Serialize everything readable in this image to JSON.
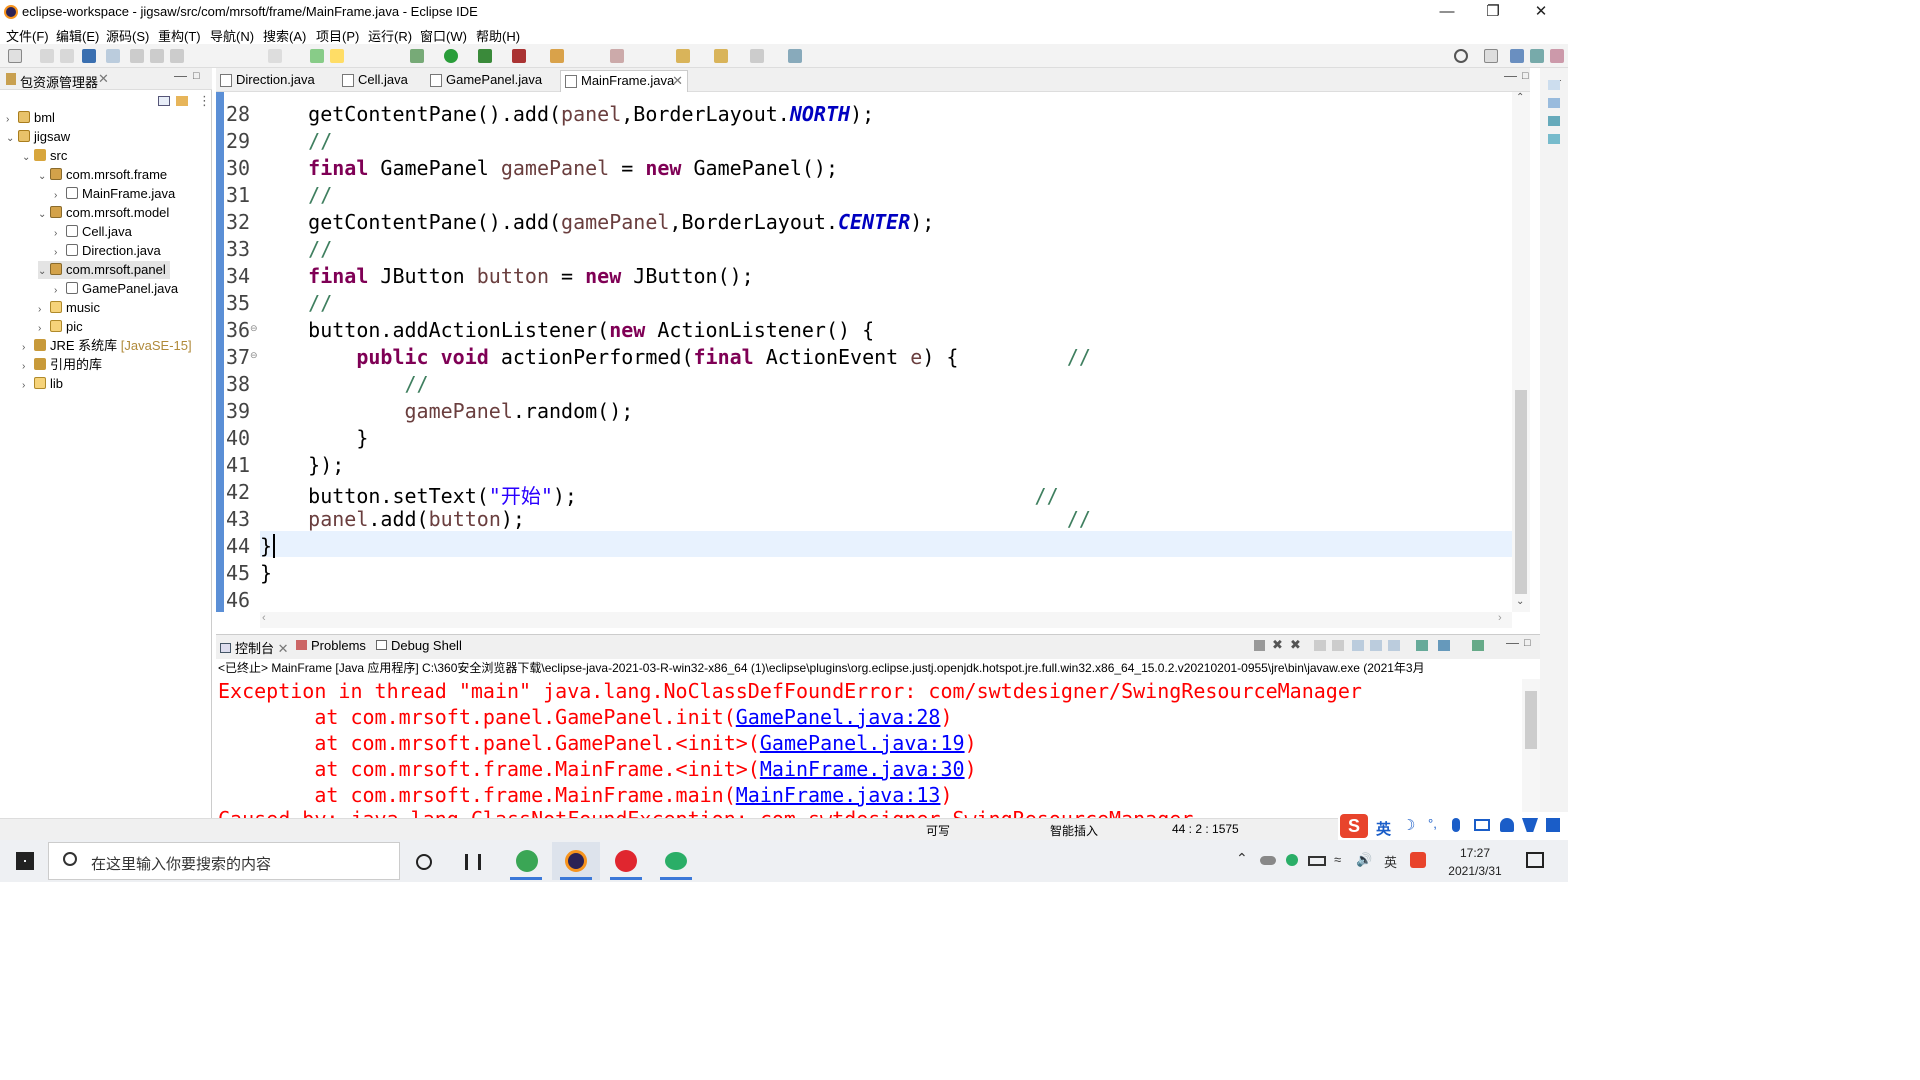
{
  "window": {
    "title": "eclipse-workspace - jigsaw/src/com/mrsoft/frame/MainFrame.java - Eclipse IDE"
  },
  "menu": [
    "文件(F)",
    "编辑(E)",
    "源码(S)",
    "重构(T)",
    "导航(N)",
    "搜索(A)",
    "项目(P)",
    "运行(R)",
    "窗口(W)",
    "帮助(H)"
  ],
  "explorer": {
    "title": "包资源管理器",
    "items": [
      {
        "label": "bml",
        "extra": ""
      },
      {
        "label": "jigsaw",
        "extra": ""
      },
      {
        "label": "src",
        "extra": ""
      },
      {
        "label": "com.mrsoft.frame",
        "extra": ""
      },
      {
        "label": "MainFrame.java",
        "extra": ""
      },
      {
        "label": "com.mrsoft.model",
        "extra": ""
      },
      {
        "label": "Cell.java",
        "extra": ""
      },
      {
        "label": "Direction.java",
        "extra": ""
      },
      {
        "label": "com.mrsoft.panel",
        "extra": ""
      },
      {
        "label": "GamePanel.java",
        "extra": ""
      },
      {
        "label": "music",
        "extra": ""
      },
      {
        "label": "pic",
        "extra": ""
      },
      {
        "label": "JRE 系统库",
        "extra": "[JavaSE-15]"
      },
      {
        "label": "引用的库",
        "extra": ""
      },
      {
        "label": "lib",
        "extra": ""
      }
    ]
  },
  "editor": {
    "tabs": [
      "Direction.java",
      "Cell.java",
      "GamePanel.java",
      "MainFrame.java"
    ],
    "active_tab": "MainFrame.java",
    "line_numbers": [
      "28",
      "29",
      "30",
      "31",
      "32",
      "33",
      "34",
      "35",
      "36",
      "37",
      "38",
      "39",
      "40",
      "41",
      "42",
      "43",
      "44",
      "45",
      "46"
    ],
    "code": {
      "l28a": "getContentPane().add(",
      "l28b": "panel",
      "l28c": ",BorderLayout.",
      "l28d": "NORTH",
      "l28e": ");",
      "l29": "//",
      "l30a": "final",
      "l30b": " GamePanel ",
      "l30c": "gamePanel",
      "l30d": " = ",
      "l30e": "new",
      "l30f": " GamePanel();",
      "l31": "//",
      "l32a": "getContentPane().add(",
      "l32b": "gamePanel",
      "l32c": ",BorderLayout.",
      "l32d": "CENTER",
      "l32e": ");",
      "l33": "//",
      "l34a": "final",
      "l34b": " JButton ",
      "l34c": "button",
      "l34d": " = ",
      "l34e": "new",
      "l34f": " JButton();",
      "l35": "//",
      "l36a": "button.addActionListener(",
      "l36b": "new",
      "l36c": " ActionListener() {",
      "l37a": "public",
      "l37b": "void",
      "l37c": " actionPerformed(",
      "l37d": "final",
      "l37e": " ActionEvent ",
      "l37f": "e",
      "l37g": ") {",
      "l37h": "//",
      "l38": "//",
      "l39a": "gamePanel",
      "l39b": ".random();",
      "l40": "}",
      "l41": "});",
      "l42a": "button.setText(",
      "l42b": "\"开始\"",
      "l42c": ");",
      "l42d": "//",
      "l43a": "panel",
      "l43b": ".add(",
      "l43c": "button",
      "l43d": ");",
      "l43e": "//",
      "l44": "}",
      "l45": "}"
    }
  },
  "console": {
    "tabs": [
      "控制台",
      "Problems",
      "Debug Shell"
    ],
    "path": "<已终止> MainFrame [Java 应用程序] C:\\360安全浏览器下载\\eclipse-java-2021-03-R-win32-x86_64 (1)\\eclipse\\plugins\\org.eclipse.justj.openjdk.hotspot.jre.full.win32.x86_64_15.0.2.v20210201-0955\\jre\\bin\\javaw.exe  (2021年3月",
    "lines": [
      {
        "text": "Exception in thread \"main\" java.lang.NoClassDefFoundError: com/swtdesigner/SwingResourceManager",
        "pre": "",
        "link": "",
        "post": ""
      },
      {
        "text": "",
        "pre": "        at com.mrsoft.panel.GamePanel.init(",
        "link": "GamePanel.java:28",
        "post": ")"
      },
      {
        "text": "",
        "pre": "        at com.mrsoft.panel.GamePanel.<init>(",
        "link": "GamePanel.java:19",
        "post": ")"
      },
      {
        "text": "",
        "pre": "        at com.mrsoft.frame.MainFrame.<init>(",
        "link": "MainFrame.java:30",
        "post": ")"
      },
      {
        "text": "",
        "pre": "        at com.mrsoft.frame.MainFrame.main(",
        "link": "MainFrame.java:13",
        "post": ")"
      },
      {
        "text": "Caused by: java.lang.ClassNotFoundException: com.swtdesigner.SwingResourceManager",
        "pre": "",
        "link": "",
        "post": ""
      }
    ]
  },
  "status": {
    "writable": "可写",
    "insert": "智能插入",
    "position": "44 : 2 : 1575"
  },
  "taskbar": {
    "search_placeholder": "在这里输入你要搜索的内容",
    "time": "17:27",
    "date": "2021/3/31",
    "ime_lang": "英",
    "tray_lang": "英"
  },
  "colors": {
    "error": "#ff0000",
    "link": "#0000ff",
    "keyword": "#7f0055",
    "comment": "#3f7f5f",
    "string": "#2a00ff",
    "constant": "#0000c0",
    "variable": "#6a3e3e",
    "current_line": "#e8f2fe",
    "gutter_bar": "#5b8fd6"
  }
}
